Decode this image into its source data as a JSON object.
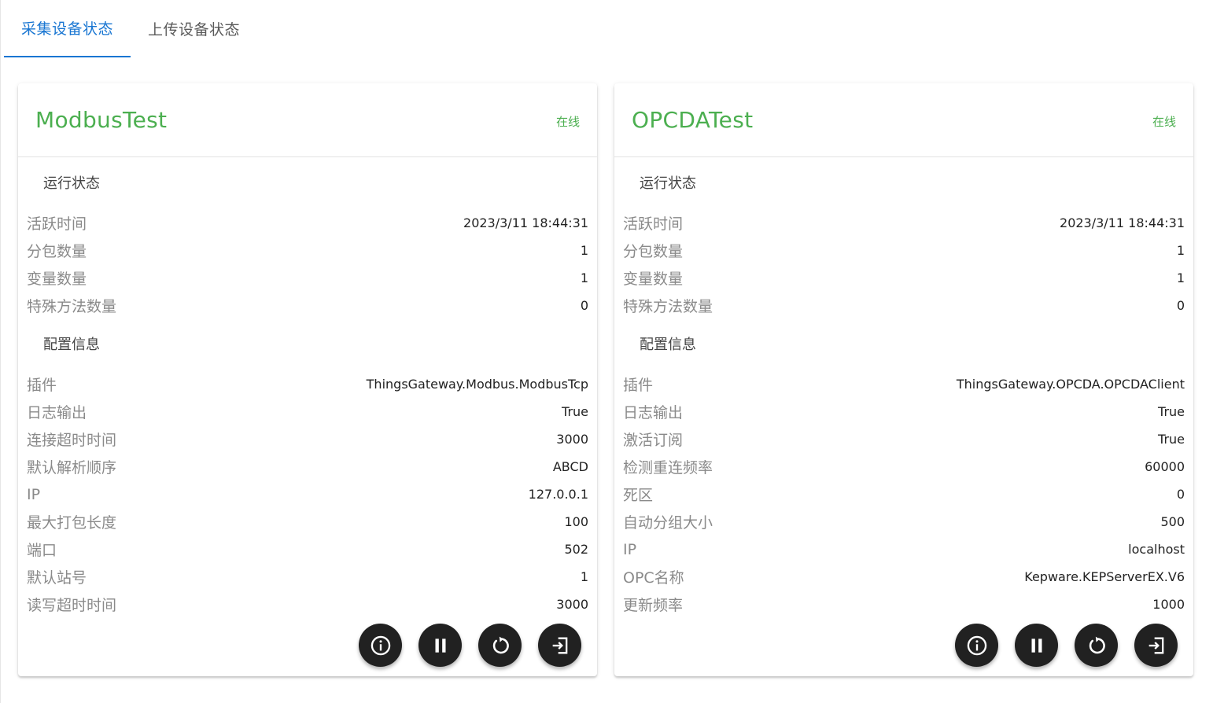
{
  "tabs": [
    {
      "label": "采集设备状态",
      "active": true
    },
    {
      "label": "上传设备状态",
      "active": false
    }
  ],
  "accent_color": "#1976d2",
  "online_color": "#4caf50",
  "cards": [
    {
      "name": "ModbusTest",
      "status": "在线",
      "runtime_title": "运行状态",
      "runtime": [
        {
          "k": "活跃时间",
          "v": "2023/3/11 18:44:31"
        },
        {
          "k": "分包数量",
          "v": "1"
        },
        {
          "k": "变量数量",
          "v": "1"
        },
        {
          "k": "特殊方法数量",
          "v": "0"
        }
      ],
      "config_title": "配置信息",
      "config": [
        {
          "k": "插件",
          "v": "ThingsGateway.Modbus.ModbusTcp"
        },
        {
          "k": "日志输出",
          "v": "True"
        },
        {
          "k": "连接超时时间",
          "v": "3000"
        },
        {
          "k": "默认解析顺序",
          "v": "ABCD"
        },
        {
          "k": "IP",
          "v": "127.0.0.1"
        },
        {
          "k": "最大打包长度",
          "v": "100"
        },
        {
          "k": "端口",
          "v": "502"
        },
        {
          "k": "默认站号",
          "v": "1"
        },
        {
          "k": "读写超时时间",
          "v": "3000"
        }
      ],
      "actions": [
        "info-icon",
        "pause-icon",
        "restart-icon",
        "exit-icon"
      ]
    },
    {
      "name": "OPCDATest",
      "status": "在线",
      "runtime_title": "运行状态",
      "runtime": [
        {
          "k": "活跃时间",
          "v": "2023/3/11 18:44:31"
        },
        {
          "k": "分包数量",
          "v": "1"
        },
        {
          "k": "变量数量",
          "v": "1"
        },
        {
          "k": "特殊方法数量",
          "v": "0"
        }
      ],
      "config_title": "配置信息",
      "config": [
        {
          "k": "插件",
          "v": "ThingsGateway.OPCDA.OPCDAClient"
        },
        {
          "k": "日志输出",
          "v": "True"
        },
        {
          "k": "激活订阅",
          "v": "True"
        },
        {
          "k": "检测重连频率",
          "v": "60000"
        },
        {
          "k": "死区",
          "v": "0"
        },
        {
          "k": "自动分组大小",
          "v": "500"
        },
        {
          "k": "IP",
          "v": "localhost"
        },
        {
          "k": "OPC名称",
          "v": "Kepware.KEPServerEX.V6"
        },
        {
          "k": "更新频率",
          "v": "1000"
        }
      ],
      "actions": [
        "info-icon",
        "pause-icon",
        "restart-icon",
        "exit-icon"
      ]
    }
  ]
}
